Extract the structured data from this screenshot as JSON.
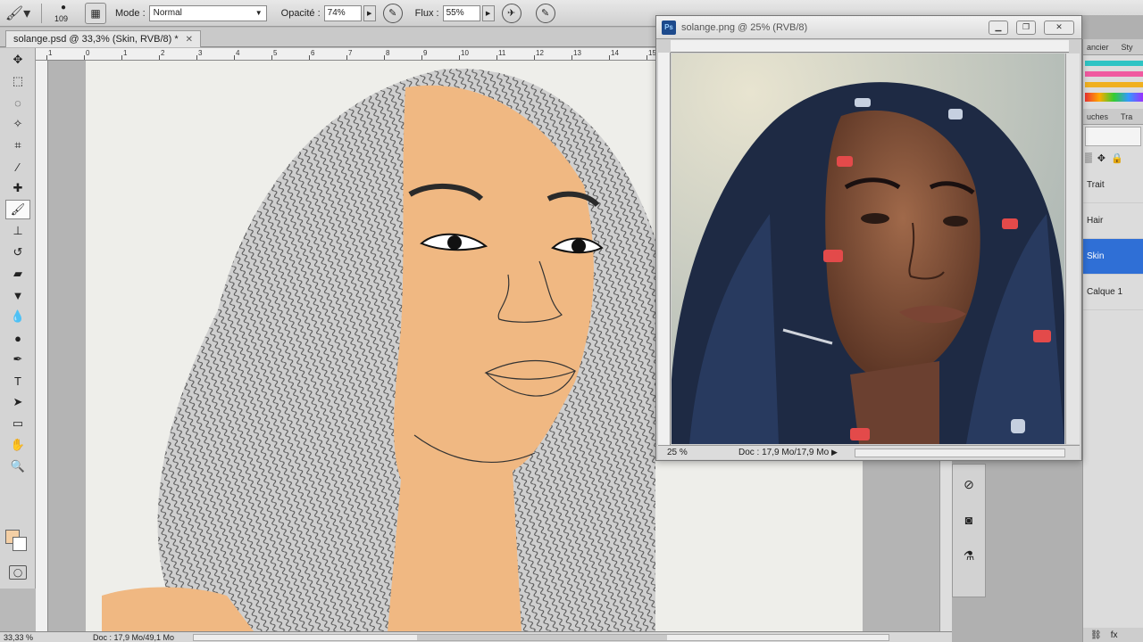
{
  "options_bar": {
    "brush_size": "109",
    "mode_label": "Mode :",
    "mode_value": "Normal",
    "opacity_label": "Opacité :",
    "opacity_value": "74%",
    "flow_label": "Flux :",
    "flow_value": "55%"
  },
  "main_doc": {
    "tab_title": "solange.psd @ 33,3% (Skin, RVB/8) *",
    "zoom": "33,33 %",
    "doc_info": "Doc : 17,9 Mo/49,1 Mo",
    "ruler_marks": [
      "1",
      "0",
      "1",
      "2",
      "3",
      "4",
      "5",
      "6",
      "7",
      "8",
      "9",
      "10",
      "11",
      "12",
      "13",
      "14",
      "15"
    ]
  },
  "float_doc": {
    "title": "solange.png @ 25% (RVB/8)",
    "zoom": "25 %",
    "doc_info": "Doc : 17,9 Mo/17,9 Mo",
    "ps_badge": "Ps"
  },
  "right_panel": {
    "tab_top": "ancier",
    "tab_top2": "Sty",
    "tab_layers": "uches",
    "tab_layers2": "Tra",
    "layers": [
      "Trait",
      "Hair",
      "Skin",
      "Calque 1"
    ],
    "selected_layer": "Skin",
    "bottom_fx": "fx"
  },
  "colors": {
    "foreground": "#f4cfa5",
    "background": "#ffffff",
    "selection": "#2f6fd6",
    "skin": "#f0b882"
  }
}
